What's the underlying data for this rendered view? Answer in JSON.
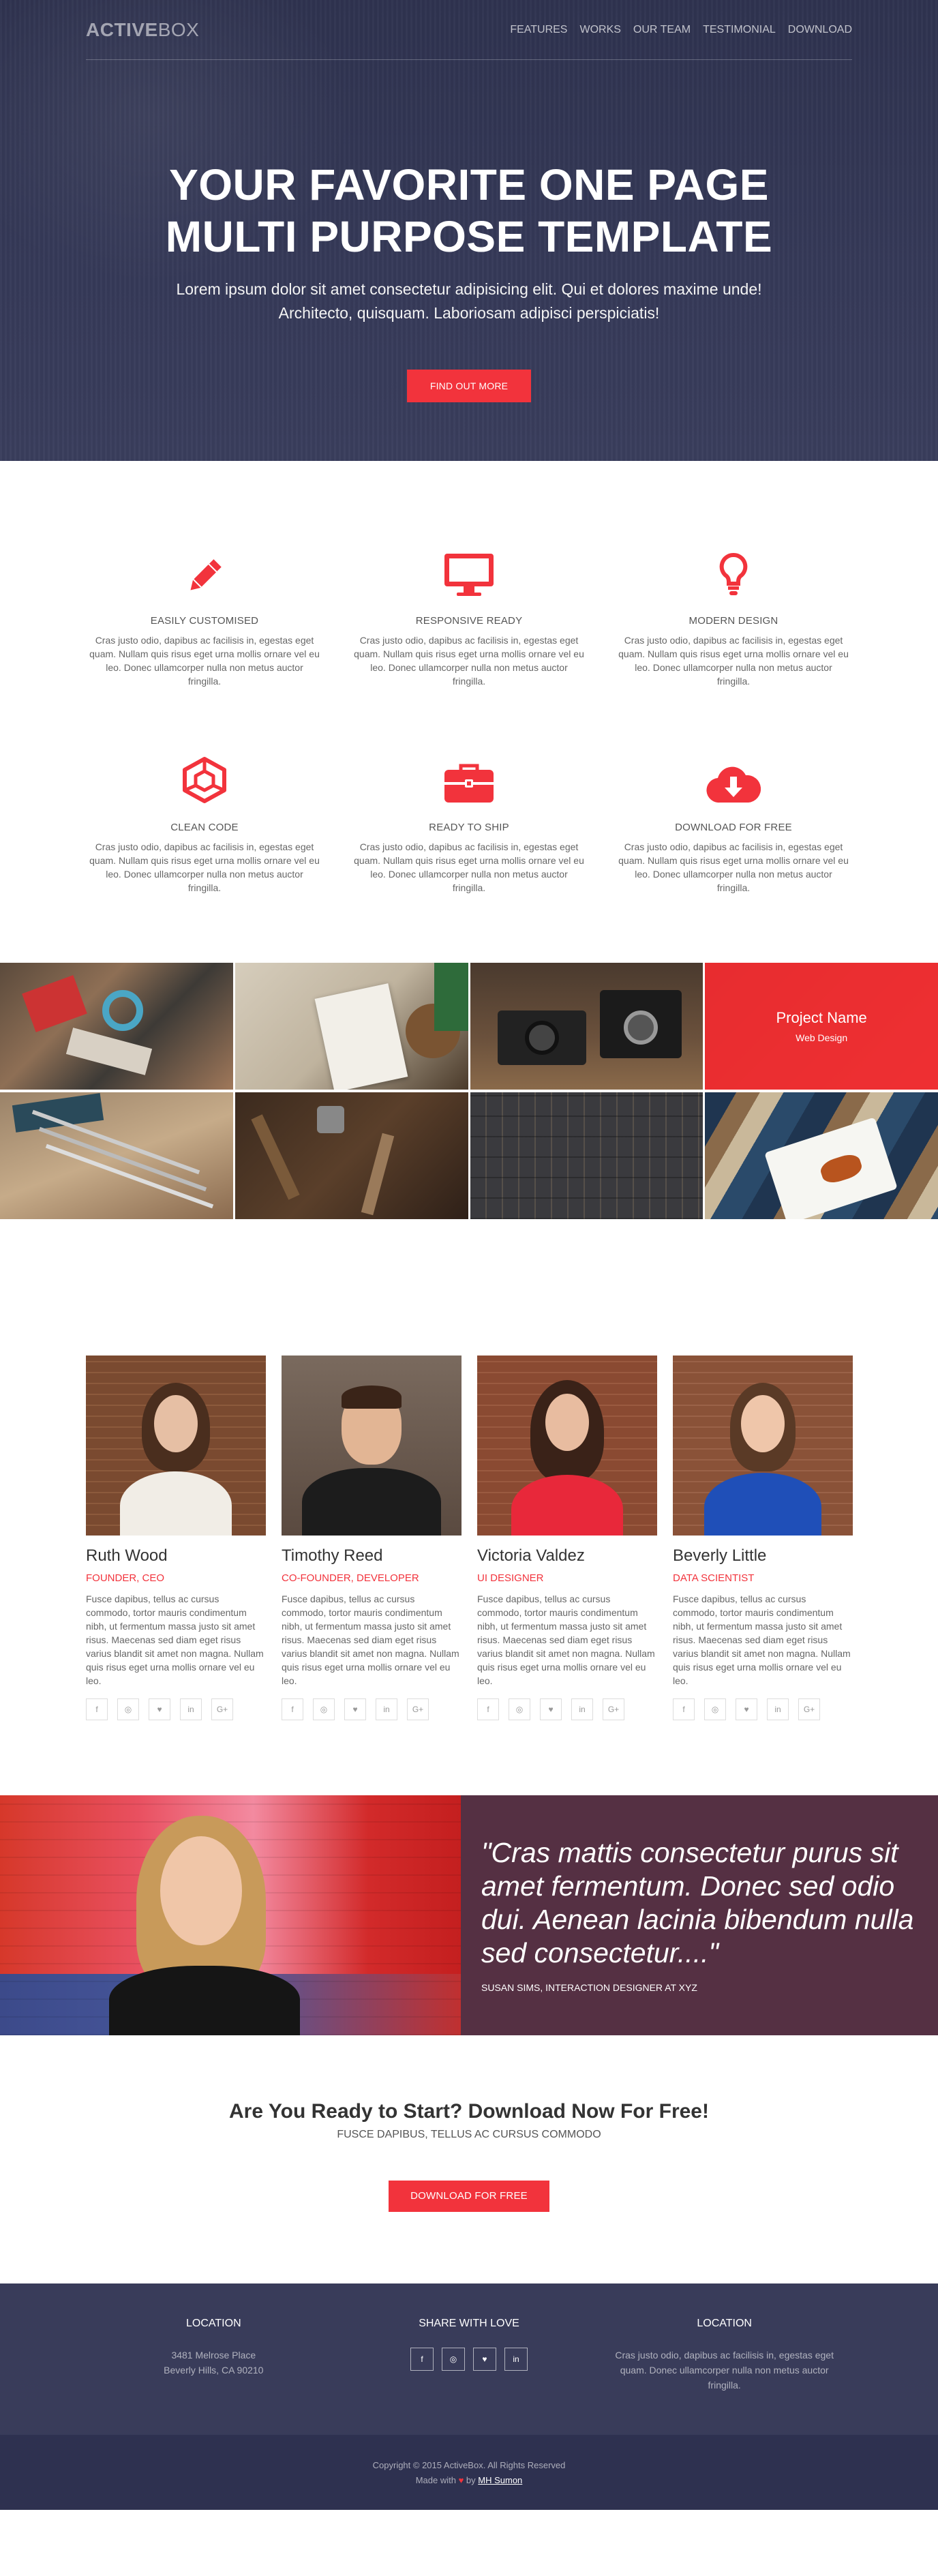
{
  "brand": {
    "bold": "ACTIVE",
    "light": "BOX"
  },
  "nav": [
    "FEATURES",
    "WORKS",
    "OUR TEAM",
    "TESTIMONIAL",
    "DOWNLOAD"
  ],
  "hero": {
    "title": "YOUR FAVORITE ONE PAGE MULTI PURPOSE TEMPLATE",
    "subtitle": "Lorem ipsum dolor sit amet consectetur adipisicing elit. Qui et dolores maxime unde! Architecto, quisquam. Laboriosam adipisci perspiciatis!",
    "cta": "FIND OUT MORE"
  },
  "features": [
    {
      "icon": "pencil-icon",
      "title": "EASILY CUSTOMISED",
      "text": "Cras justo odio, dapibus ac facilisis in, egestas eget quam. Nullam quis risus eget urna mollis ornare vel eu leo. Donec ullamcorper nulla non metus auctor fringilla."
    },
    {
      "icon": "monitor-icon",
      "title": "RESPONSIVE READY",
      "text": "Cras justo odio, dapibus ac facilisis in, egestas eget quam. Nullam quis risus eget urna mollis ornare vel eu leo. Donec ullamcorper nulla non metus auctor fringilla."
    },
    {
      "icon": "lightbulb-icon",
      "title": "MODERN DESIGN",
      "text": "Cras justo odio, dapibus ac facilisis in, egestas eget quam. Nullam quis risus eget urna mollis ornare vel eu leo. Donec ullamcorper nulla non metus auctor fringilla."
    },
    {
      "icon": "cube-icon",
      "title": "CLEAN CODE",
      "text": "Cras justo odio, dapibus ac facilisis in, egestas eget quam. Nullam quis risus eget urna mollis ornare vel eu leo. Donec ullamcorper nulla non metus auctor fringilla."
    },
    {
      "icon": "briefcase-icon",
      "title": "READY TO SHIP",
      "text": "Cras justo odio, dapibus ac facilisis in, egestas eget quam. Nullam quis risus eget urna mollis ornare vel eu leo. Donec ullamcorper nulla non metus auctor fringilla."
    },
    {
      "icon": "cloud-download-icon",
      "title": "DOWNLOAD FOR FREE",
      "text": "Cras justo odio, dapibus ac facilisis in, egestas eget quam. Nullam quis risus eget urna mollis ornare vel eu leo. Donec ullamcorper nulla non metus auctor fringilla."
    }
  ],
  "portfolio": {
    "overlay": {
      "name": "Project Name",
      "category": "Web Design"
    },
    "tiles": [
      "design-tools-photo",
      "sketchbook-photo",
      "cameras-photo",
      "project-highlight",
      "pencils-photo",
      "hand-tools-photo",
      "letterpress-photo",
      "food-plate-photo"
    ]
  },
  "team": [
    {
      "name": "Ruth Wood",
      "role": "FOUNDER, CEO",
      "bio": "Fusce dapibus, tellus ac cursus commodo, tortor mauris condimentum nibh, ut fermentum massa justo sit amet risus. Maecenas sed diam eget risus varius blandit sit amet non magna. Nullam quis risus eget urna mollis ornare vel eu leo."
    },
    {
      "name": "Timothy Reed",
      "role": "CO-FOUNDER, DEVELOPER",
      "bio": "Fusce dapibus, tellus ac cursus commodo, tortor mauris condimentum nibh, ut fermentum massa justo sit amet risus. Maecenas sed diam eget risus varius blandit sit amet non magna. Nullam quis risus eget urna mollis ornare vel eu leo."
    },
    {
      "name": "Victoria Valdez",
      "role": "UI DESIGNER",
      "bio": "Fusce dapibus, tellus ac cursus commodo, tortor mauris condimentum nibh, ut fermentum massa justo sit amet risus. Maecenas sed diam eget risus varius blandit sit amet non magna. Nullam quis risus eget urna mollis ornare vel eu leo."
    },
    {
      "name": "Beverly Little",
      "role": "DATA SCIENTIST",
      "bio": "Fusce dapibus, tellus ac cursus commodo, tortor mauris condimentum nibh, ut fermentum massa justo sit amet risus. Maecenas sed diam eget risus varius blandit sit amet non magna. Nullam quis risus eget urna mollis ornare vel eu leo."
    }
  ],
  "social_glyphs": {
    "facebook": "f",
    "instagram": "◎",
    "twitter": "♥",
    "linkedin": "in",
    "googleplus": "G+"
  },
  "testimonial": {
    "quote": "\"Cras mattis consectetur purus sit amet fermentum. Donec sed odio dui. Aenean lacinia bibendum nulla sed consectetur....\"",
    "author": "SUSAN SIMS, INTERACTION DESIGNER AT XYZ"
  },
  "download": {
    "title": "Are You Ready to Start? Download Now For Free!",
    "subtitle": "FUSCE DAPIBUS, TELLUS AC CURSUS COMMODO",
    "cta": "DOWNLOAD FOR FREE"
  },
  "footer": {
    "location_title": "LOCATION",
    "address_line1": "3481 Melrose Place",
    "address_line2": "Beverly Hills, CA 90210",
    "share_title": "SHARE WITH LOVE",
    "location2_title": "LOCATION",
    "location2_text": "Cras justo odio, dapibus ac facilisis in, egestas eget quam. Donec ullamcorper nulla non metus auctor fringilla.",
    "copyright": "Copyright © 2015 ActiveBox. All Rights Reserved",
    "made_with_prefix": "Made with",
    "made_with_by": "by",
    "author": "MH Sumon"
  },
  "colors": {
    "accent": "#f2333c",
    "hero_bg": "#353956",
    "footer_bg": "#393c5a",
    "bottom_bar": "#2e3150",
    "testimonial_bg": "#553043"
  }
}
